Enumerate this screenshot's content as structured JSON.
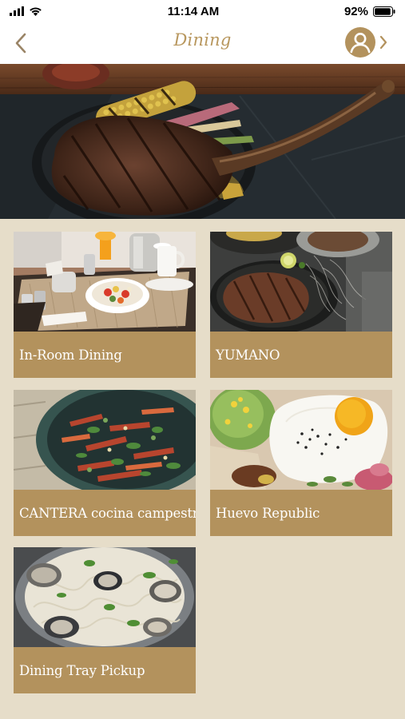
{
  "status_bar": {
    "time": "11:14 AM",
    "battery": "92%"
  },
  "nav": {
    "title": "Dining",
    "back_icon": "chevron-left-icon",
    "profile_icon": "user-circle-icon"
  },
  "colors": {
    "accent": "#b3925d",
    "title_gold": "#b8975e",
    "background": "#e6ddc9"
  },
  "venues": [
    {
      "label": "In-Room Dining"
    },
    {
      "label": "YUMANO"
    },
    {
      "label": "CANTERA cocina campestre"
    },
    {
      "label": "Huevo Republic"
    },
    {
      "label": "Dining Tray Pickup"
    }
  ]
}
